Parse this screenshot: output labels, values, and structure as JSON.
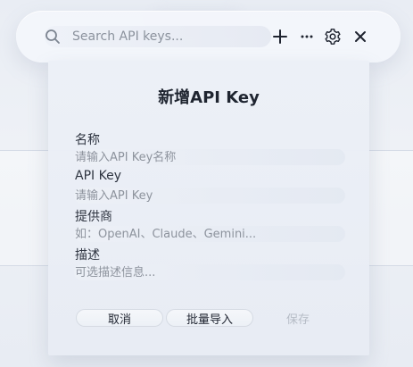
{
  "toolbar": {
    "search_placeholder": "Search API keys...",
    "icons": {
      "search": "search-icon",
      "plus": "plus-icon",
      "more": "more-horizontal-icon",
      "settings": "gear-icon",
      "close": "close-icon"
    }
  },
  "modal": {
    "title": "新增API Key",
    "fields": {
      "name": {
        "label": "名称",
        "placeholder": "请输入API Key名称"
      },
      "api_key": {
        "label": "API Key",
        "placeholder": "请输入API Key"
      },
      "provider": {
        "label": "提供商",
        "placeholder": "如：OpenAI、Claude、Gemini..."
      },
      "description": {
        "label": "描述",
        "placeholder": "可选描述信息..."
      }
    },
    "buttons": {
      "cancel": "取消",
      "batch_import": "批量导入",
      "save": "保存"
    }
  }
}
